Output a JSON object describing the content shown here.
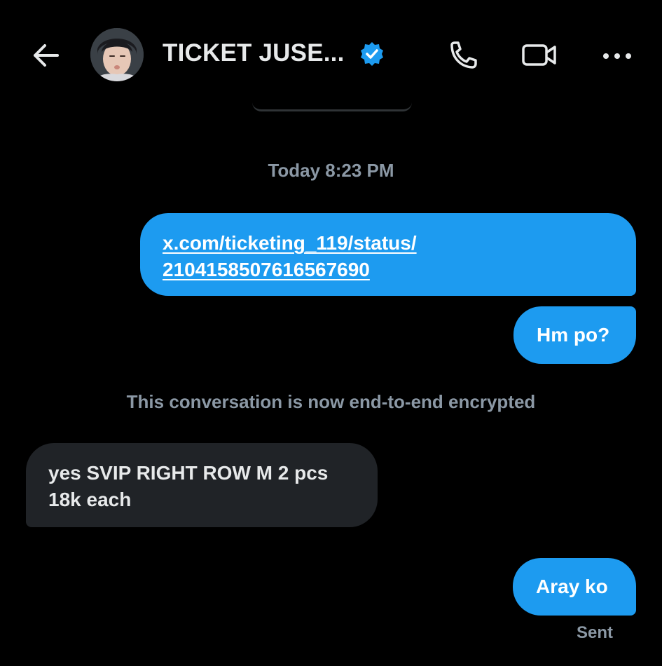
{
  "header": {
    "title": "TICKET JUSE...",
    "back_icon": "arrow-left-icon",
    "verified_icon": "verified-badge-icon",
    "call_icon": "phone-icon",
    "video_icon": "video-camera-icon",
    "more_icon": "more-horizontal-icon"
  },
  "colors": {
    "background": "#000000",
    "outgoing_bubble": "#1d9bf0",
    "incoming_bubble": "#202327",
    "muted_text": "#8b98a5",
    "verified": "#1d9bf0"
  },
  "conversation": {
    "timestamp": "Today 8:23 PM",
    "messages": [
      {
        "direction": "outgoing",
        "link_line1": "x.com/ticketing_119/status/",
        "link_line2": "2104158507616567690"
      },
      {
        "direction": "outgoing",
        "text": "Hm po?"
      }
    ],
    "system_note": "This conversation is now end-to-end encrypted",
    "after_note": [
      {
        "direction": "incoming",
        "line1": "yes SVIP RIGHT ROW M 2 pcs",
        "line2": "18k each"
      },
      {
        "direction": "outgoing",
        "text": "Aray ko"
      }
    ],
    "status": "Sent"
  }
}
